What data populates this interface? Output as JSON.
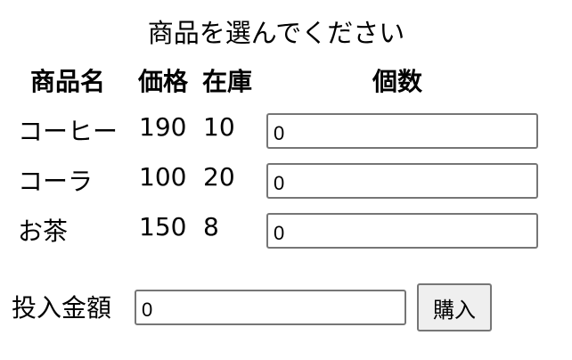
{
  "title": "商品を選んでください",
  "table": {
    "headers": {
      "name": "商品名",
      "price": "価格",
      "stock": "在庫",
      "quantity": "個数"
    },
    "rows": [
      {
        "name": "コーヒー",
        "price": "190",
        "stock": "10",
        "quantity": "0"
      },
      {
        "name": "コーラ",
        "price": "100",
        "stock": "20",
        "quantity": "0"
      },
      {
        "name": "お茶",
        "price": "150",
        "stock": "8",
        "quantity": "0"
      }
    ]
  },
  "payment": {
    "label": "投入金額",
    "amount": "0",
    "buy_label": "購入"
  }
}
